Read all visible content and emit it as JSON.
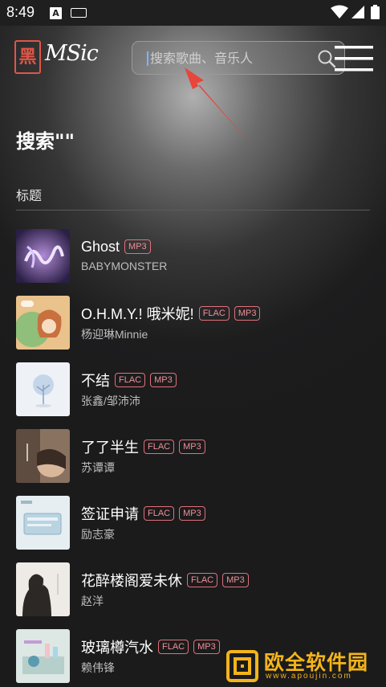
{
  "status_bar": {
    "time": "8:49",
    "keyboard_indicator": "A",
    "icons": [
      "text-input-icon",
      "keyboard-icon",
      "wifi-icon",
      "signal-icon",
      "battery-icon"
    ]
  },
  "header": {
    "logo_char": "黑",
    "logo_text": "MSic",
    "search_placeholder": "搜索歌曲、音乐人",
    "accent": "#e25545"
  },
  "page": {
    "title": "搜索\"\"",
    "section_label": "标题"
  },
  "songs": [
    {
      "title": "Ghost",
      "artist": "BABYMONSTER",
      "badges": [
        "MP3"
      ]
    },
    {
      "title": "O.H.M.Y.! 哦米妮!",
      "artist": "杨迎琳Minnie",
      "badges": [
        "FLAC",
        "MP3"
      ]
    },
    {
      "title": "不结",
      "artist": "张鑫/邹沛沛",
      "badges": [
        "FLAC",
        "MP3"
      ]
    },
    {
      "title": "了了半生",
      "artist": "苏谭谭",
      "badges": [
        "FLAC",
        "MP3"
      ]
    },
    {
      "title": "签证申请",
      "artist": "励志豪",
      "badges": [
        "FLAC",
        "MP3"
      ]
    },
    {
      "title": "花醉楼阁爱未休",
      "artist": "赵洋",
      "badges": [
        "FLAC",
        "MP3"
      ]
    },
    {
      "title": "玻璃樽汽水",
      "artist": "赖伟锋",
      "badges": [
        "FLAC",
        "MP3"
      ]
    }
  ],
  "watermark": {
    "text": "欧全软件园",
    "url": "www.apoujin.com"
  },
  "colors": {
    "badge_border": "#e0707a",
    "arrow": "#e8453c",
    "watermark": "#f4b41a"
  }
}
